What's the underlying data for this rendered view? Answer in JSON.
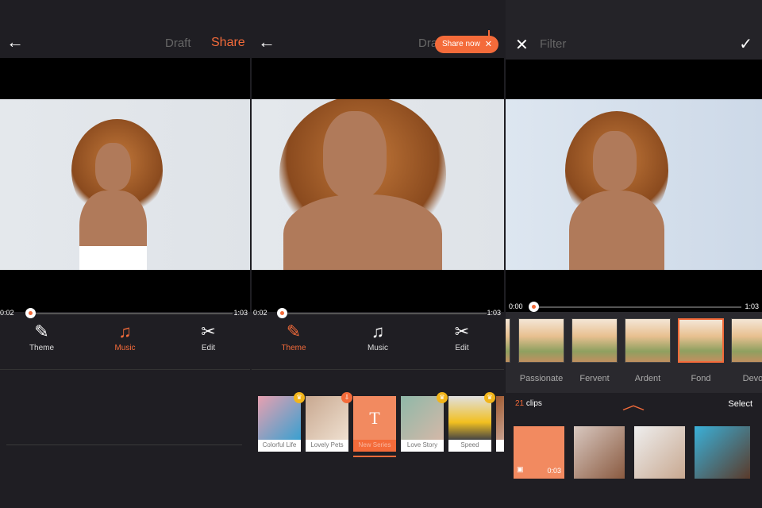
{
  "panel1": {
    "draft": "Draft",
    "share": "Share",
    "time_start": "0:02",
    "time_end": "1:03",
    "progress": 0.03,
    "tools": [
      {
        "label": "Theme",
        "icon": "magic-wand-icon"
      },
      {
        "label": "Music",
        "icon": "music-note-icon"
      },
      {
        "label": "Edit",
        "icon": "scissors-icon"
      }
    ],
    "active_tool": "Music"
  },
  "panel2": {
    "draft": "Draft",
    "share_now": "Share now",
    "time_start": "0:02",
    "time_end": "1:03",
    "progress": 0.03,
    "tools": [
      {
        "label": "Theme",
        "icon": "magic-wand-icon"
      },
      {
        "label": "Music",
        "icon": "music-note-icon"
      },
      {
        "label": "Edit",
        "icon": "scissors-icon"
      }
    ],
    "active_tool": "Theme",
    "themes": [
      {
        "label": "Colorful Life",
        "badge": "crown"
      },
      {
        "label": "Lovely Pets",
        "badge": "download"
      },
      {
        "label": "New Series",
        "badge": "",
        "selected": true,
        "glyph": "T"
      },
      {
        "label": "Love Story",
        "badge": "crown"
      },
      {
        "label": "Speed",
        "badge": "crown"
      },
      {
        "label": "Fr",
        "badge": ""
      }
    ]
  },
  "panel3": {
    "title": "Filter",
    "time_start": "0:00",
    "time_end": "1:03",
    "progress": 0.0,
    "filters": [
      "Passionate",
      "Fervent",
      "Ardent",
      "Fond",
      "Devot"
    ],
    "selected_filter": "Fond",
    "clips_count": "21",
    "clips_label": "clips",
    "select": "Select",
    "first_clip_duration": "0:03"
  },
  "colors": {
    "accent": "#f46b3a",
    "crown": "#f2b51a",
    "background": "#1f1e23"
  }
}
